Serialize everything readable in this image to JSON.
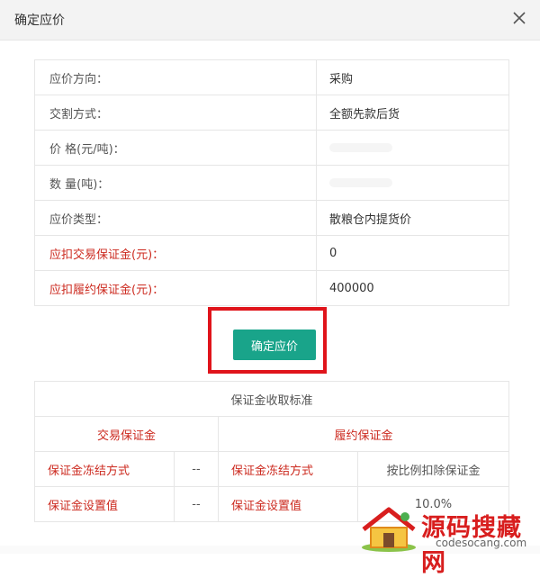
{
  "dialog": {
    "title": "确定应价"
  },
  "info_rows": [
    {
      "label": "应价方向：",
      "value": "采购",
      "highlight": false
    },
    {
      "label": "交割方式：",
      "value": "全额先款后货",
      "highlight": false
    },
    {
      "label": "价 格(元/吨)：",
      "value": "",
      "highlight": false
    },
    {
      "label": "数 量(吨)：",
      "value": "",
      "highlight": false
    },
    {
      "label": "应价类型：",
      "value": "散粮仓内提货价",
      "highlight": false
    },
    {
      "label": "应扣交易保证金(元)：",
      "value": "0",
      "highlight": true
    },
    {
      "label": "应扣履约保证金(元)：",
      "value": "400000",
      "highlight": true
    }
  ],
  "confirm_button": {
    "label": "确定应价"
  },
  "deposit_standard": {
    "title": "保证金收取标准",
    "trade_header": "交易保证金",
    "performance_header": "履约保证金",
    "rows": [
      {
        "trade_label": "保证金冻结方式",
        "trade_value": "--",
        "perf_label": "保证金冻结方式",
        "perf_value": "按比例扣除保证金"
      },
      {
        "trade_label": "保证金设置值",
        "trade_value": "--",
        "perf_label": "保证金设置值",
        "perf_value": "10.0%"
      }
    ]
  },
  "watermark": {
    "text": "源码搜藏网",
    "subtext": "codesocang.com"
  },
  "colors": {
    "accent": "#19a48a",
    "highlight_red": "#cc2a1f",
    "annotation_border": "#e0141b"
  }
}
